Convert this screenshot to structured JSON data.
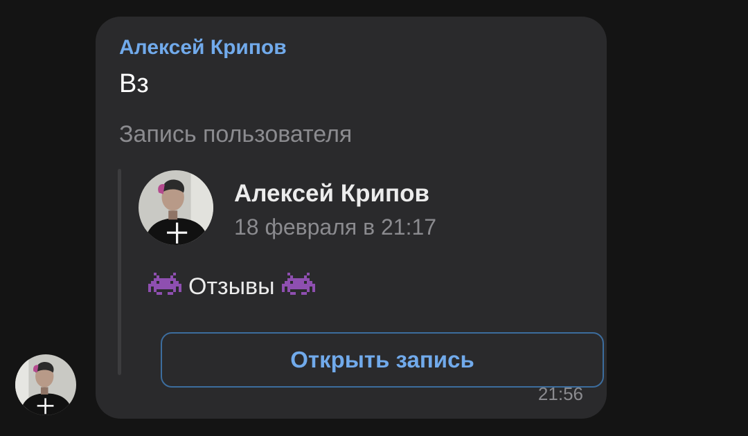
{
  "message": {
    "author": "Алексей Крипов",
    "text": "Вз",
    "repost_label": "Запись пользователя",
    "time": "21:56"
  },
  "repost": {
    "author": "Алексей Крипов",
    "date": "18 февраля в 21:17",
    "text": "Отзывы",
    "emoji_icon": "space-invader-icon",
    "open_button_label": "Открыть запись"
  },
  "colors": {
    "background": "#141414",
    "bubble": "#2a2a2c",
    "accent": "#71aaeb",
    "muted_text": "#8b8b8f",
    "button_border": "#3c6d9e",
    "emoji": "#8e4fb0"
  }
}
